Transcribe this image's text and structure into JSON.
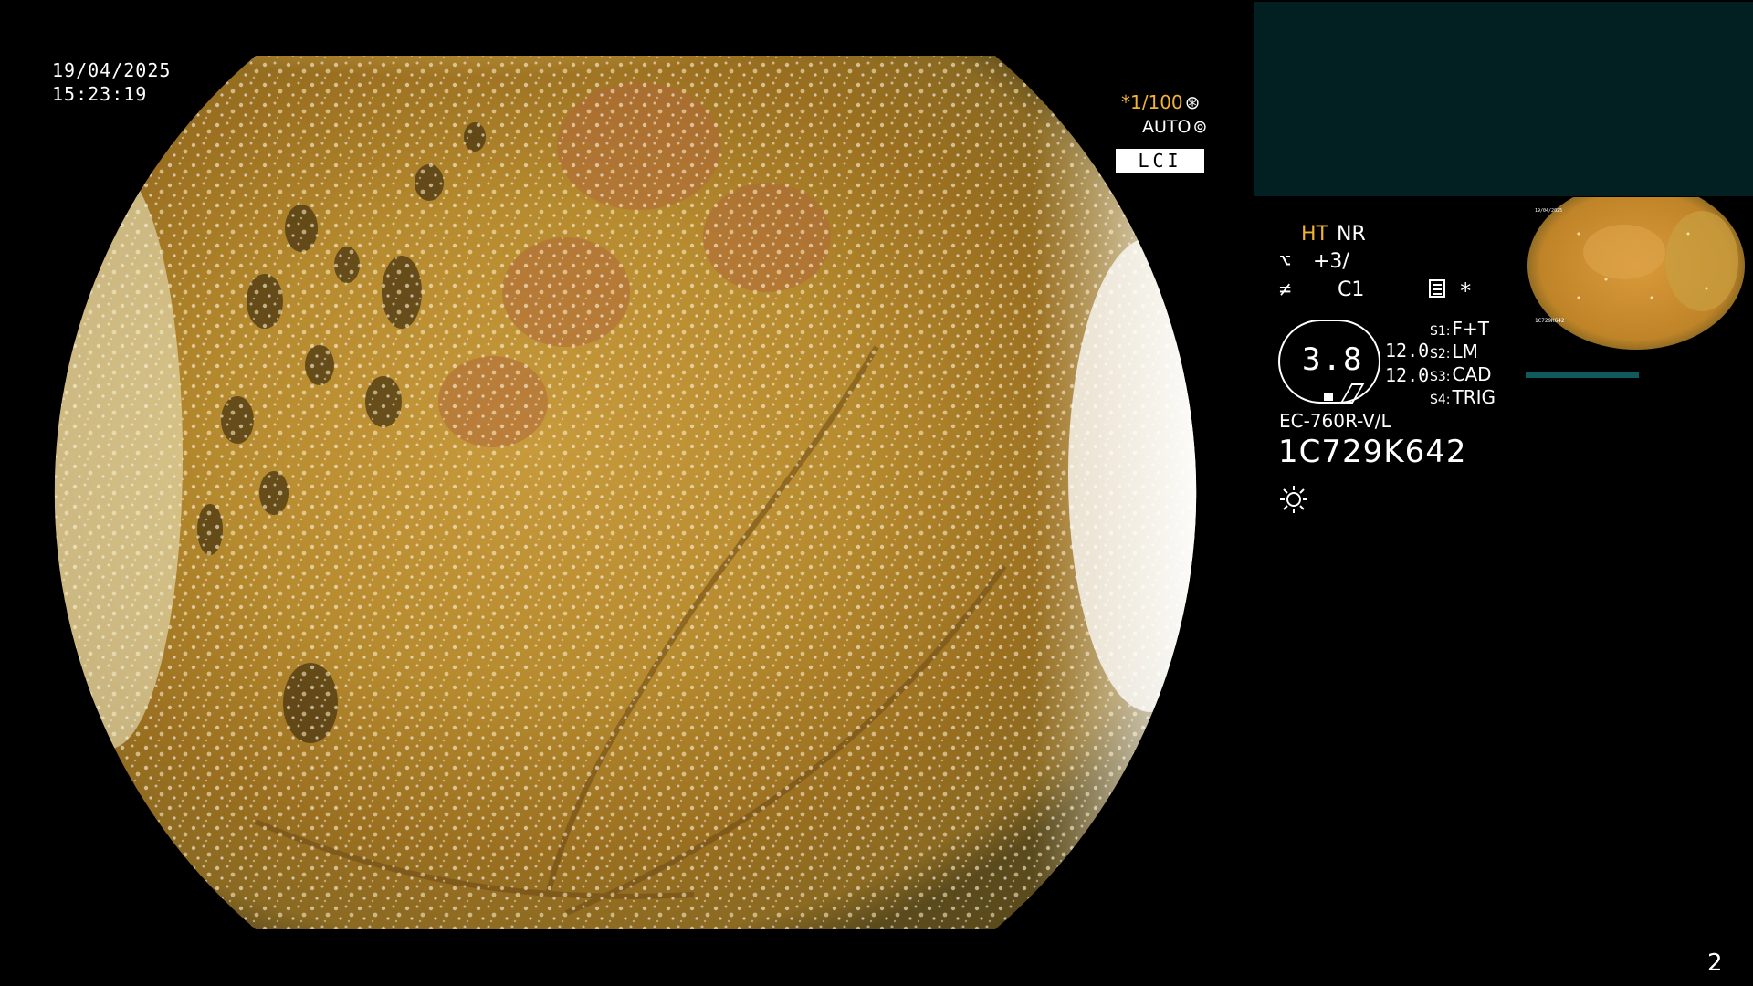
{
  "overlay": {
    "date": "19/04/2025",
    "time": "15:23:19",
    "shutter": "*1/100",
    "iris": "AUTO",
    "mode": "LCI"
  },
  "panel": {
    "ht": "HT",
    "nr": "NR",
    "enhancement": "+3/",
    "color": "C1",
    "asterisk": "*",
    "gauge": "3.8",
    "values": [
      "12.0",
      "12.0"
    ],
    "switches": [
      {
        "key": "S1:",
        "value": "F+T"
      },
      {
        "key": "S2:",
        "value": "LM"
      },
      {
        "key": "S3:",
        "value": "CAD"
      },
      {
        "key": "S4:",
        "value": "TRIG"
      }
    ],
    "scope_model": "EC-760R-V/L",
    "scope_serial": "1C729K642"
  },
  "footer": {
    "page": "2"
  },
  "colors": {
    "accent": "#f2b233",
    "panel_dark": "#022021",
    "mucosa": "#b8862a"
  },
  "icons": [
    "shutter-wheel-icon",
    "iris-wheel-icon",
    "enhancement-icon",
    "color-icon",
    "record-icon",
    "light-icon"
  ]
}
